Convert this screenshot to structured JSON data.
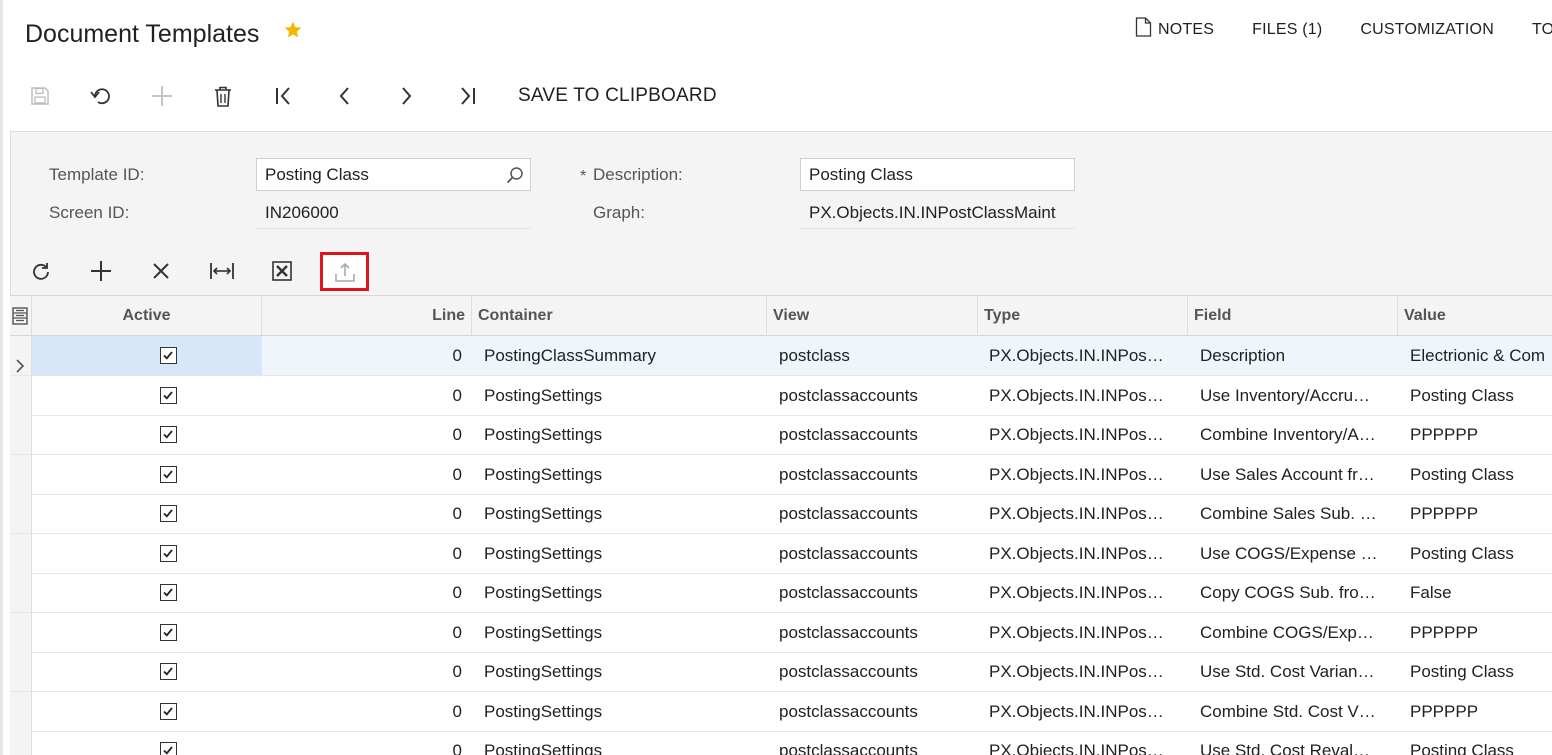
{
  "header": {
    "title": "Document Templates",
    "links": {
      "notes": "NOTES",
      "files": "FILES (1)",
      "customization": "CUSTOMIZATION",
      "tools": "TO"
    }
  },
  "toolbar": {
    "save_to_clipboard": "SAVE TO CLIPBOARD"
  },
  "form": {
    "template_id_label": "Template ID:",
    "template_id_value": "Posting Class",
    "screen_id_label": "Screen ID:",
    "screen_id_value": "IN206000",
    "required_mark": "*",
    "description_label": "Description:",
    "description_value": "Posting Class",
    "graph_label": "Graph:",
    "graph_value": "PX.Objects.IN.INPostClassMaint"
  },
  "grid": {
    "columns": {
      "active": "Active",
      "line": "Line",
      "container": "Container",
      "view": "View",
      "type": "Type",
      "field": "Field",
      "value": "Value"
    },
    "rows": [
      {
        "active": true,
        "line": "0",
        "container": "PostingClassSummary",
        "view": "postclass",
        "type": "PX.Objects.IN.INPos…",
        "field": "Description",
        "value": "Electrionic & Com"
      },
      {
        "active": true,
        "line": "0",
        "container": "PostingSettings",
        "view": "postclassaccounts",
        "type": "PX.Objects.IN.INPos…",
        "field": "Use Inventory/Accru…",
        "value": "Posting Class"
      },
      {
        "active": true,
        "line": "0",
        "container": "PostingSettings",
        "view": "postclassaccounts",
        "type": "PX.Objects.IN.INPos…",
        "field": "Combine Inventory/A…",
        "value": "PPPPPP"
      },
      {
        "active": true,
        "line": "0",
        "container": "PostingSettings",
        "view": "postclassaccounts",
        "type": "PX.Objects.IN.INPos…",
        "field": "Use Sales Account fr…",
        "value": "Posting Class"
      },
      {
        "active": true,
        "line": "0",
        "container": "PostingSettings",
        "view": "postclassaccounts",
        "type": "PX.Objects.IN.INPos…",
        "field": "Combine Sales Sub. …",
        "value": "PPPPPP"
      },
      {
        "active": true,
        "line": "0",
        "container": "PostingSettings",
        "view": "postclassaccounts",
        "type": "PX.Objects.IN.INPos…",
        "field": "Use COGS/Expense …",
        "value": "Posting Class"
      },
      {
        "active": true,
        "line": "0",
        "container": "PostingSettings",
        "view": "postclassaccounts",
        "type": "PX.Objects.IN.INPos…",
        "field": "Copy COGS Sub. fro…",
        "value": "False"
      },
      {
        "active": true,
        "line": "0",
        "container": "PostingSettings",
        "view": "postclassaccounts",
        "type": "PX.Objects.IN.INPos…",
        "field": "Combine COGS/Exp…",
        "value": "PPPPPP"
      },
      {
        "active": true,
        "line": "0",
        "container": "PostingSettings",
        "view": "postclassaccounts",
        "type": "PX.Objects.IN.INPos…",
        "field": "Use Std. Cost Varian…",
        "value": "Posting Class"
      },
      {
        "active": true,
        "line": "0",
        "container": "PostingSettings",
        "view": "postclassaccounts",
        "type": "PX.Objects.IN.INPos…",
        "field": "Combine Std. Cost V…",
        "value": "PPPPPP"
      },
      {
        "active": true,
        "line": "0",
        "container": "PostingSettings",
        "view": "postclassaccounts",
        "type": "PX.Objects.IN.INPos…",
        "field": "Use Std. Cost Reval…",
        "value": "Posting Class"
      }
    ]
  },
  "colors": {
    "star": "#f5b400",
    "highlight_border": "#e0151b",
    "selected_row": "#d6e8f7"
  }
}
